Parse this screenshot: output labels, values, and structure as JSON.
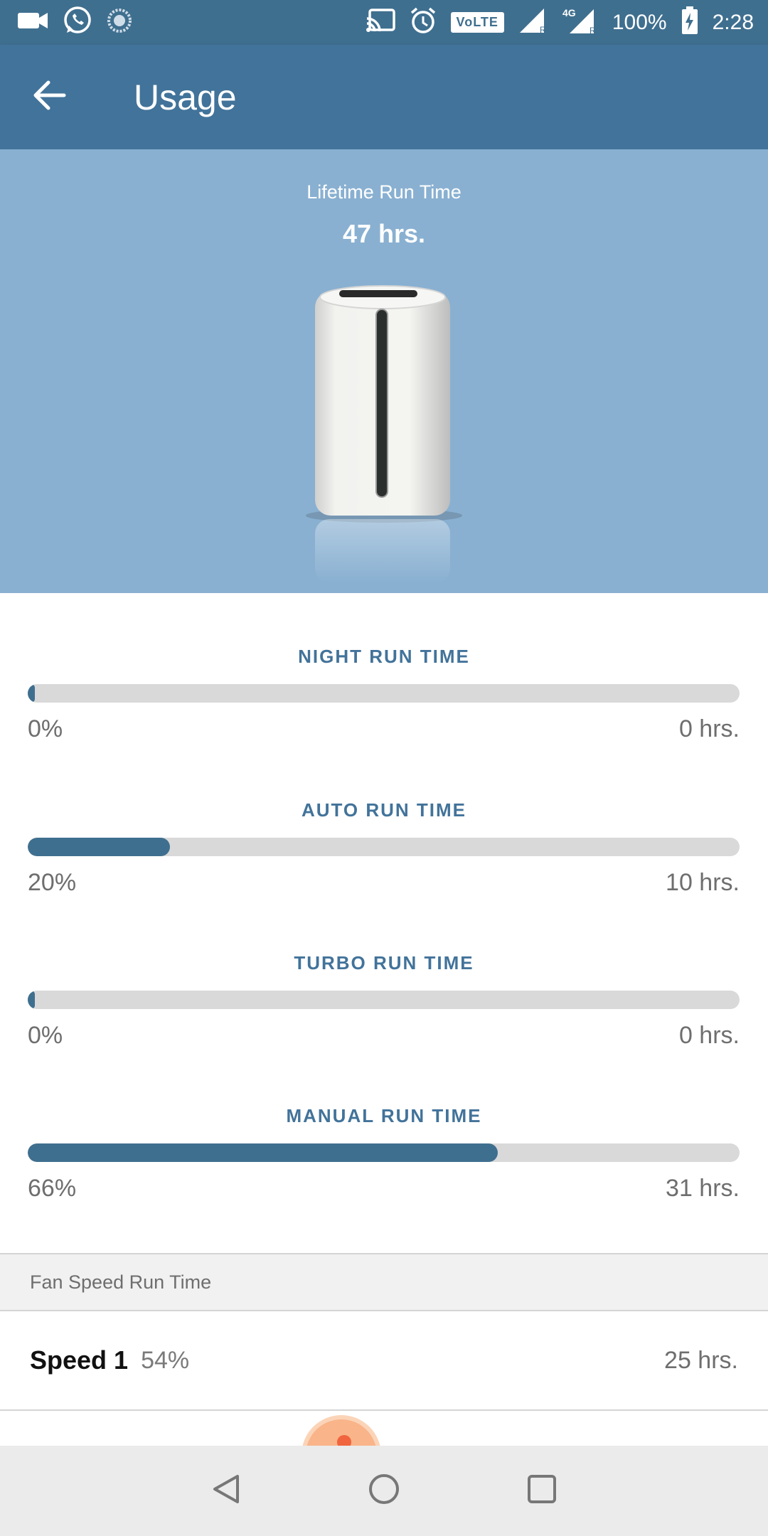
{
  "status_bar": {
    "battery": "100%",
    "time": "2:28",
    "network": "4G",
    "volte": "VoLTE",
    "icons": [
      "video-camera-icon",
      "whatsapp-icon",
      "sync-icon",
      "cast-icon",
      "alarm-icon",
      "volte-badge",
      "signal-icon",
      "signal-4g-icon",
      "battery-charging-icon"
    ]
  },
  "app_bar": {
    "back_icon": "arrow-left-icon",
    "title": "Usage"
  },
  "hero": {
    "label": "Lifetime Run Time",
    "value": "47 hrs.",
    "image": "air-purifier"
  },
  "metrics": [
    {
      "title": "NIGHT RUN TIME",
      "percent_label": "0%",
      "percent": 0,
      "hours": "0 hrs."
    },
    {
      "title": "AUTO RUN TIME",
      "percent_label": "20%",
      "percent": 20,
      "hours": "10 hrs."
    },
    {
      "title": "TURBO RUN TIME",
      "percent_label": "0%",
      "percent": 0,
      "hours": "0 hrs."
    },
    {
      "title": "MANUAL RUN TIME",
      "percent_label": "66%",
      "percent": 66,
      "hours": "31 hrs."
    }
  ],
  "fan_speed": {
    "header": "Fan Speed Run Time",
    "rows": [
      {
        "name": "Speed 1",
        "percent": "54%",
        "hours": "25 hrs."
      }
    ]
  },
  "nav_bar": {
    "icons": [
      "back-triangle-icon",
      "home-circle-icon",
      "recents-square-icon"
    ]
  },
  "colors": {
    "status_bar": "#3f6f8f",
    "app_bar": "#42739a",
    "hero_bg": "#89b0d1",
    "accent": "#42739a",
    "bar_fill": "#3f6f8f",
    "bar_track": "#d9d9d9"
  }
}
